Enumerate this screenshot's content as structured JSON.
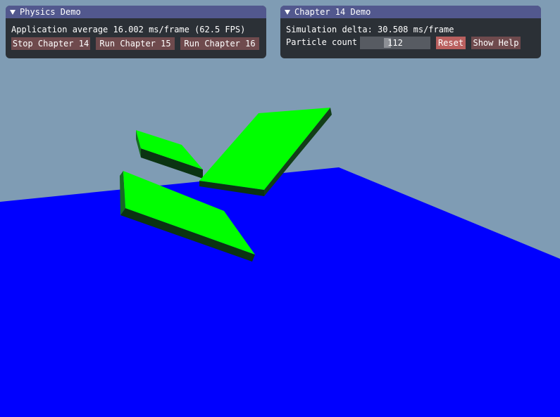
{
  "scene": {
    "sky_color": "#7f9cb4",
    "ground_color": "#0000ff",
    "plate_top_color": "#00ff00",
    "plate_edge_color": "#0a3a14",
    "plates": [
      "green-box-plate",
      "green-box-plate",
      "green-box-plate"
    ]
  },
  "physics_window": {
    "title": "Physics Demo",
    "fps_text": "Application average 16.002 ms/frame (62.5 FPS)",
    "buttons": [
      "Stop Chapter 14",
      "Run Chapter 15",
      "Run Chapter 16"
    ]
  },
  "chapter_window": {
    "title": "Chapter 14 Demo",
    "sim_delta_text": "Simulation delta: 30.508 ms/frame",
    "particle_label": "Particle count",
    "particle_value": "112",
    "reset_label": "Reset",
    "help_label": "Show Help"
  },
  "colors": {
    "title_bar": "#52588e",
    "window_bg": "#26292e",
    "button": "#6f4a4d",
    "reset_button": "#b9605f",
    "slider_bg": "#575b62"
  }
}
